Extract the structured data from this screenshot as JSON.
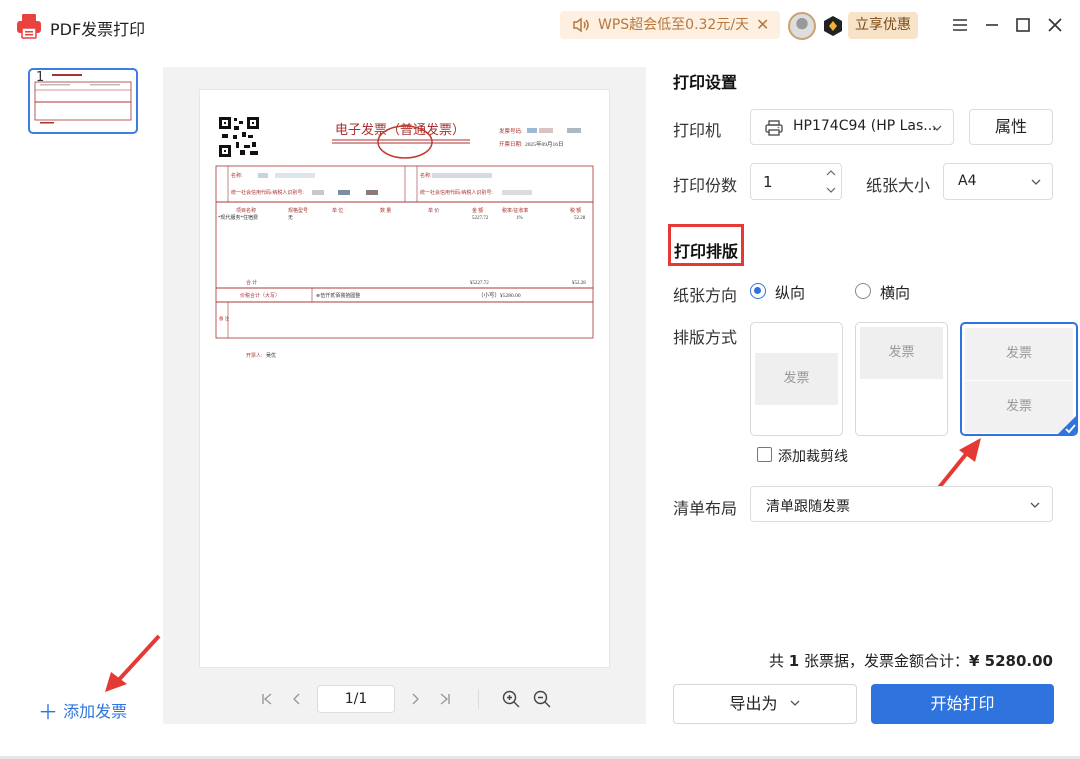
{
  "app": {
    "title": "PDF发票打印"
  },
  "promo": {
    "text": "WPS超会低至0.32元/天"
  },
  "header": {
    "share_label": "立享优惠"
  },
  "thumbnails": [
    {
      "page_number": "1"
    }
  ],
  "sidebar": {
    "add_label": "添加发票"
  },
  "invoice": {
    "title": "电子发票（普通发票）",
    "number_label": "发票号码:",
    "date_label": "开票日期:",
    "date_value": "2025年09月16日",
    "buyer_label": "名称:",
    "taxid_label": "统一社会信用代码/纳税人识别号:",
    "col_item": "项目名称",
    "col_model": "规格型号",
    "col_unit": "单 位",
    "col_qty": "数 量",
    "col_price": "单 价",
    "col_amount": "金 额",
    "col_rate": "税率/征收率",
    "col_tax": "税 额",
    "item_name": "*现代服务*住宿费",
    "item_model": "无",
    "item_amount": "5227.72",
    "item_rate": "1%",
    "item_tax": "52.28",
    "total_label": "合 计",
    "total_amount": "¥5227.72",
    "total_tax": "¥52.28",
    "total_words_label": "价税合计（大写）",
    "total_words": "⊗伍仟贰佰捌拾圆整",
    "total_small": "（小写）¥5280.00",
    "remark_label": "备 注",
    "issuer_label": "开票人:",
    "issuer_value": "吴优"
  },
  "pager": {
    "page_indicator": "1/1"
  },
  "print_settings": {
    "title": "打印设置",
    "printer_label": "打印机",
    "printer_value": "HP174C94 (HP Las...",
    "properties_label": "属性",
    "copies_label": "打印份数",
    "copies_value": "1",
    "paper_size_label": "纸张大小",
    "paper_size_value": "A4"
  },
  "layout_settings": {
    "title": "打印排版",
    "orientation_label": "纸张方向",
    "orientation_options": [
      "纵向",
      "横向"
    ],
    "orientation_selected": "纵向",
    "layout_label": "排版方式",
    "layout_card_text": "发票",
    "crop_line_label": "添加裁剪线",
    "list_layout_label": "清单布局",
    "list_layout_value": "清单跟随发票"
  },
  "summary": {
    "prefix": "共",
    "count": "1",
    "middle": "张票据，发票金额合计：",
    "amount": "¥ 5280.00"
  },
  "actions": {
    "export_label": "导出为",
    "print_label": "开始打印"
  },
  "colors": {
    "accent": "#2f74de",
    "highlight_red": "#e53935",
    "invoice_red": "#a83232"
  }
}
